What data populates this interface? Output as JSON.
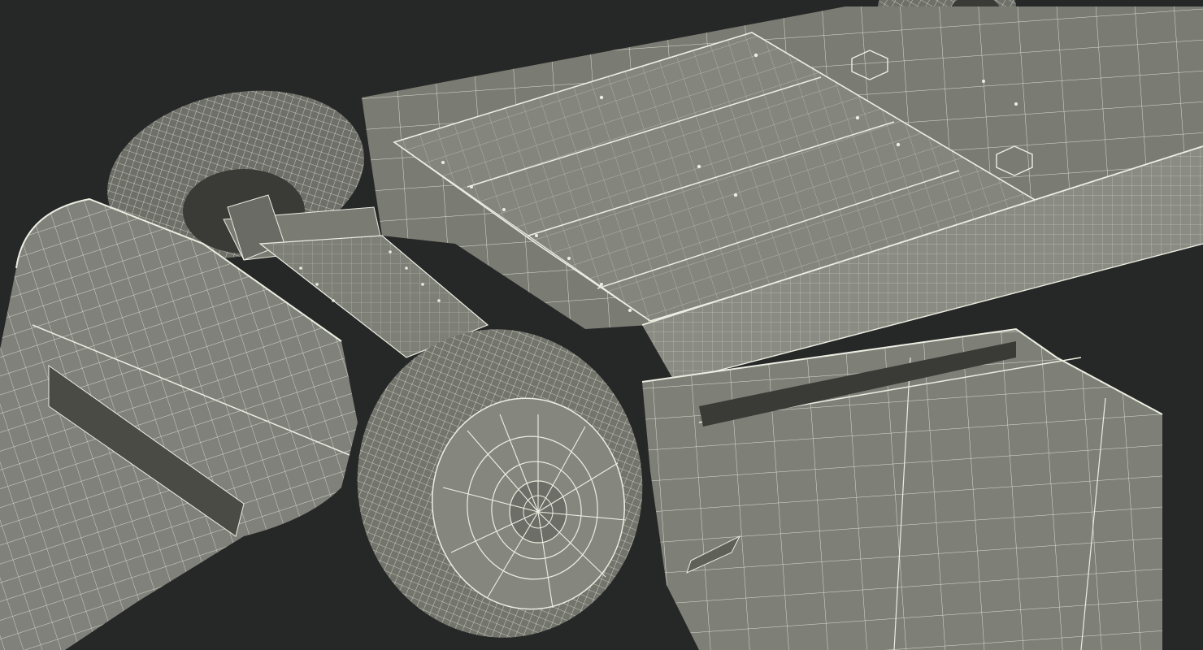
{
  "scene": {
    "subject": "wireframe-car-underbody",
    "colors": {
      "background": "#262727",
      "surface": "#7e7f77",
      "surface_light": "#8f9088",
      "surface_dark": "#5f6058",
      "shadow": "#3a3b36",
      "wire": "#eceee2"
    }
  }
}
